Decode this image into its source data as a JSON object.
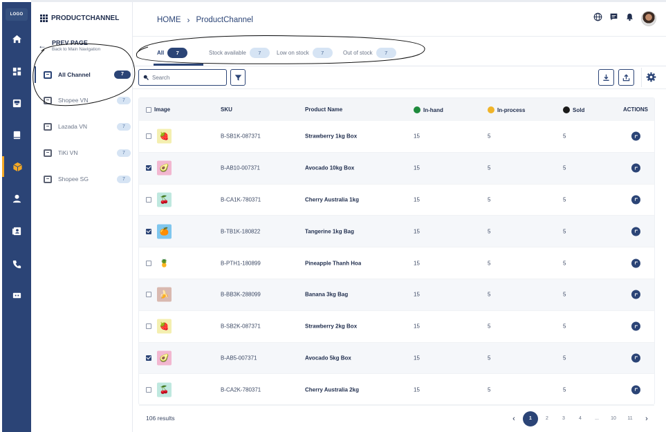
{
  "rail": {
    "logo": "LOGO",
    "items": [
      {
        "icon": "home-icon"
      },
      {
        "icon": "dashboard-icon"
      },
      {
        "icon": "inbox-icon"
      },
      {
        "icon": "book-icon"
      },
      {
        "icon": "package-icon",
        "active": true
      },
      {
        "icon": "user-icon"
      },
      {
        "icon": "contacts-icon"
      },
      {
        "icon": "phone-icon"
      },
      {
        "icon": "ticket-icon"
      }
    ],
    "accent": "#f4a825",
    "color": "#2b4476"
  },
  "panel": {
    "brand": "PRODUCTCHANNEL",
    "prev_title": "PREV PAGE",
    "prev_sub": "Back to Main Navigation",
    "channels": [
      {
        "label": "All Channel",
        "count": "7",
        "active": true
      },
      {
        "label": "Shopee VN",
        "count": "7"
      },
      {
        "label": "Lazada VN",
        "count": "7"
      },
      {
        "label": "TiKi VN",
        "count": "7"
      },
      {
        "label": "Shopee SG",
        "count": "7"
      }
    ]
  },
  "header": {
    "crumb_home": "HOME",
    "crumb_sep": "›",
    "crumb_current": "ProductChannel"
  },
  "tabs": [
    {
      "label": "All",
      "count": "7",
      "active": true
    },
    {
      "label": "Stock available",
      "count": "7"
    },
    {
      "label": "Low on stock",
      "count": "7"
    },
    {
      "label": "Out of stock",
      "count": "7"
    }
  ],
  "toolbar": {
    "search_placeholder": "Search"
  },
  "table": {
    "columns": {
      "image": "Image",
      "sku": "SKU",
      "product": "Product Name",
      "inhand": "In-hand",
      "inprocess": "In-process",
      "sold": "Sold",
      "actions": "ACTIONS"
    },
    "status_colors": {
      "inhand": "#1e8a3c",
      "inprocess": "#f0b429",
      "sold": "#1a1a1a"
    },
    "rows": [
      {
        "checked": false,
        "fruit": "strawberry",
        "thumb_bg": "#f4efb0",
        "glyph": "🍓",
        "sku": "B-SB1K-087371",
        "name": "Strawberry 1kg Box",
        "inhand": "15",
        "inprocess": "5",
        "sold": "5"
      },
      {
        "checked": true,
        "fruit": "avocado",
        "thumb_bg": "#f2b7d0",
        "glyph": "🥑",
        "sku": "B-AB10-007371",
        "name": "Avocado 10kg Box",
        "inhand": "15",
        "inprocess": "5",
        "sold": "5"
      },
      {
        "checked": false,
        "fruit": "cherry",
        "thumb_bg": "#bfe8df",
        "glyph": "🍒",
        "sku": "B-CA1K-780371",
        "name": "Cherry Australia 1kg",
        "inhand": "15",
        "inprocess": "5",
        "sold": "5"
      },
      {
        "checked": true,
        "fruit": "tangerine",
        "thumb_bg": "#7fc6ee",
        "glyph": "🍊",
        "sku": "B-TB1K-180822",
        "name": "Tangerine 1kg Bag",
        "inhand": "15",
        "inprocess": "5",
        "sold": "5"
      },
      {
        "checked": false,
        "fruit": "pineapple",
        "thumb_bg": "#ffffff",
        "glyph": "🍍",
        "sku": "B-PTH1-180899",
        "name": "Pineapple Thanh Hoa",
        "inhand": "15",
        "inprocess": "5",
        "sold": "5"
      },
      {
        "checked": false,
        "fruit": "banana",
        "thumb_bg": "#d9b9b0",
        "glyph": "🍌",
        "sku": "B-BB3K-288099",
        "name": "Banana 3kg Bag",
        "inhand": "15",
        "inprocess": "5",
        "sold": "5"
      },
      {
        "checked": false,
        "fruit": "strawberry",
        "thumb_bg": "#f4efb0",
        "glyph": "🍓",
        "sku": "B-SB2K-087371",
        "name": "Strawberry 2kg Box",
        "inhand": "15",
        "inprocess": "5",
        "sold": "5"
      },
      {
        "checked": true,
        "fruit": "avocado",
        "thumb_bg": "#f2b7d0",
        "glyph": "🥑",
        "sku": "B-AB5-007371",
        "name": "Avocado 5kg Box",
        "inhand": "15",
        "inprocess": "5",
        "sold": "5"
      },
      {
        "checked": false,
        "fruit": "cherry",
        "thumb_bg": "#bfe8df",
        "glyph": "🍒",
        "sku": "B-CA2K-780371",
        "name": "Cherry Australia 2kg",
        "inhand": "15",
        "inprocess": "5",
        "sold": "5"
      }
    ]
  },
  "footer": {
    "results": "106 results",
    "pages": [
      "1",
      "2",
      "3",
      "4",
      "...",
      "10",
      "11"
    ],
    "current_page": "1",
    "prev": "‹",
    "next": "›"
  }
}
